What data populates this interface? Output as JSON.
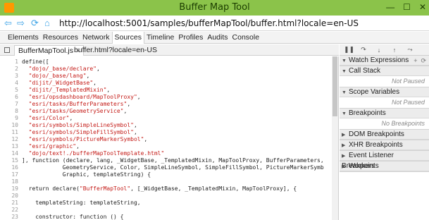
{
  "window": {
    "title": "Buffer Map Tool",
    "controls": [
      "—",
      "☐",
      "✕"
    ]
  },
  "address": {
    "nav_icons": [
      "back-icon",
      "forward-icon",
      "refresh-icon",
      "home-icon"
    ],
    "url": "http://localhost:5001/samples/bufferMapTool/buffer.html?locale=en-US"
  },
  "panel_tabs": [
    "Elements",
    "Resources",
    "Network",
    "Sources",
    "Timeline",
    "Profiles",
    "Audits",
    "Console"
  ],
  "active_panel_tab": "Sources",
  "file_tabs": [
    {
      "label": "BufferMapTool.js",
      "close": "×",
      "active": true
    },
    {
      "label": "buffer.html?locale=en-US",
      "close": "",
      "active": false
    }
  ],
  "code_lines": [
    {
      "n": "1",
      "t": "define(["
    },
    {
      "n": "2",
      "t": "  \"dojo/_base/declare\","
    },
    {
      "n": "3",
      "t": "  \"dojo/_base/lang\","
    },
    {
      "n": "4",
      "t": "  \"dijit/_WidgetBase\","
    },
    {
      "n": "5",
      "t": "  \"dijit/_TemplatedMixin\","
    },
    {
      "n": "6",
      "t": "  \"esri/opsdashboard/MapToolProxy\","
    },
    {
      "n": "7",
      "t": "  \"esri/tasks/BufferParameters\","
    },
    {
      "n": "8",
      "t": "  \"esri/tasks/GeometryService\","
    },
    {
      "n": "9",
      "t": "  \"esri/Color\","
    },
    {
      "n": "10",
      "t": "  \"esri/symbols/SimpleLineSymbol\","
    },
    {
      "n": "11",
      "t": "  \"esri/symbols/SimpleFillSymbol\","
    },
    {
      "n": "12",
      "t": "  \"esri/symbols/PictureMarkerSymbol\","
    },
    {
      "n": "13",
      "t": "  \"esri/graphic\","
    },
    {
      "n": "14",
      "t": "  \"dojo/text!./bufferMapToolTemplate.html\""
    },
    {
      "n": "15",
      "t": "], function (declare, lang, _WidgetBase, _TemplatedMixin, MapToolProxy, BufferParameters,"
    },
    {
      "n": "16",
      "t": "            GeometryService, Color, SimpleLineSymbol, SimpleFillSymbol, PictureMarkerSymb"
    },
    {
      "n": "17",
      "t": "            Graphic, templateString) {"
    },
    {
      "n": "18",
      "t": ""
    },
    {
      "n": "19",
      "t": "  return declare(\"BufferMapTool\", [_WidgetBase, _TemplatedMixin, MapToolProxy], {"
    },
    {
      "n": "20",
      "t": ""
    },
    {
      "n": "21",
      "t": "    templateString: templateString,"
    },
    {
      "n": "22",
      "t": ""
    },
    {
      "n": "23",
      "t": "    constructor: function () {"
    }
  ],
  "debugger": {
    "toolbar_icons": [
      "pause-icon",
      "step-over-icon",
      "step-into-icon",
      "step-out-icon",
      "deactivate-breakpoints-icon"
    ],
    "watch_actions": [
      "+",
      "⟳"
    ],
    "sections": [
      {
        "title": "Watch Expressions",
        "expanded": true,
        "body": ""
      },
      {
        "title": "Call Stack",
        "expanded": true,
        "body": "Not Paused"
      },
      {
        "title": "Scope Variables",
        "expanded": true,
        "body": "Not Paused"
      },
      {
        "title": "Breakpoints",
        "expanded": true,
        "body": "No Breakpoints"
      },
      {
        "title": "DOM Breakpoints",
        "expanded": false,
        "body": ""
      },
      {
        "title": "XHR Breakpoints",
        "expanded": false,
        "body": ""
      },
      {
        "title": "Event Listener Breakpoints",
        "expanded": false,
        "body": ""
      },
      {
        "title": "Workers",
        "expanded": false,
        "body": ""
      }
    ]
  },
  "colors": {
    "titlebar": "#8bc34a",
    "string": "#c41a16",
    "nav_icon": "#3da3e6"
  }
}
